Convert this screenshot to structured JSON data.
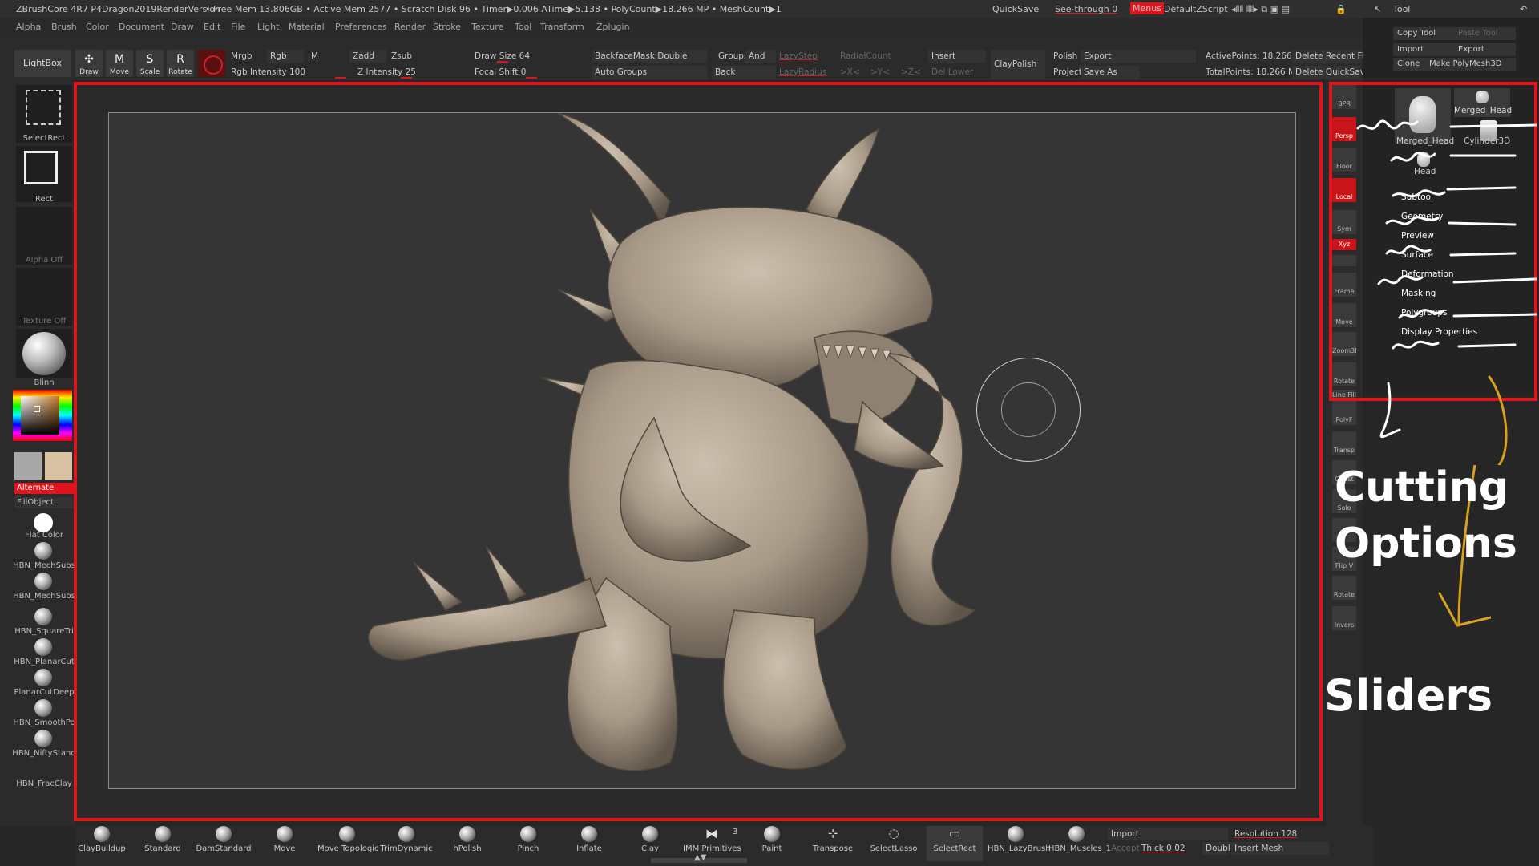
{
  "title_bar": {
    "app_title": "ZBrushCore 4R7 P4Dragon2019RenderVersion",
    "stats": "• Free Mem 13.806GB • Active Mem 2577 • Scratch Disk 96 • Timer▶0.006 ATime▶5.138 • PolyCount▶18.266 MP • MeshCount▶1",
    "quicksave": "QuickSave",
    "see_through": "See-through  0",
    "menus": "Menus",
    "default_zscript": "DefaultZScript",
    "tool_title": "Tool"
  },
  "menu_bar": [
    "Alpha",
    "Brush",
    "Color",
    "Document",
    "Draw",
    "Edit",
    "File",
    "Light",
    "Material",
    "Preferences",
    "Render",
    "Stroke",
    "Texture",
    "Tool",
    "Transform",
    "Zplugin"
  ],
  "toolbar": {
    "lightbox": "LightBox",
    "draw": "Draw",
    "move": "Move",
    "scale": "Scale",
    "rotate": "Rotate",
    "mrgb": "Mrgb",
    "rgb": "Rgb",
    "m": "M",
    "zadd": "Zadd",
    "zsub": "Zsub",
    "rgb_intensity": "Rgb Intensity 100",
    "z_intensity": "Z Intensity 25",
    "draw_size": "Draw Size 64",
    "focal_shift": "Focal Shift 0",
    "backface_mask": "BackfaceMask  Double",
    "auto_groups": "Auto Groups",
    "groups": "Groups",
    "and": "And",
    "back": "Back",
    "lazy_step": "LazyStep",
    "lazy_radius": "LazyRadius",
    "radial_count": "RadialCount",
    "x_axis": ">X<",
    "y_axis": ">Y<",
    "z_axis": ">Z<",
    "insert": "Insert",
    "del_lower": "Del Lower",
    "claypolish": "ClayPolish",
    "polish": "Polish",
    "export": "Export",
    "project": "Project",
    "save_as": "Save As",
    "active_points": "ActivePoints: 18.266 M",
    "total_points": "TotalPoints: 18.266 Mil",
    "delete_recent": "Delete Recent Fi",
    "delete_quicksave": "Delete QuickSav"
  },
  "left_shelf": {
    "select_rect": "SelectRect",
    "rect": "Rect",
    "alpha_off": "Alpha Off",
    "texture_off": "Texture Off",
    "material": "Blinn",
    "alternate": "Alternate",
    "fill_object": "FillObject",
    "flat_color": "Flat Color",
    "brushes": [
      "HBN_MechSubs",
      "HBN_MechSubs",
      "HBN_SquareTri",
      "HBN_PlanarCut",
      "PlanarCutDeep",
      "HBN_SmoothPo",
      "HBN_NiftyStand",
      "HBN_FracClay"
    ]
  },
  "right_strip": [
    "BPR",
    "Persp",
    "Floor",
    "Local",
    "Sym",
    "Xyz",
    "",
    "Frame",
    "Move",
    "Zoom3D",
    "Rotate",
    "Line Fill",
    "PolyF",
    "Transp",
    "Ghost",
    "Solo",
    "",
    "Flip V",
    "Rotate",
    "Invers"
  ],
  "tool_panel": {
    "copy_tool": "Copy Tool",
    "paste_tool": "Paste Tool",
    "import": "Import",
    "export": "Export",
    "clone": "Clone",
    "make_polymesh": "Make PolyMesh3D",
    "thumb1": "Merged_Head",
    "thumb2": "Merged_Head",
    "thumb3": "Cylinder3D",
    "thumb4": "Head",
    "items": [
      "Subtool",
      "Geometry",
      "Preview",
      "Surface",
      "Deformation",
      "Masking",
      "Polygroups",
      "Display Properties"
    ]
  },
  "annotations": {
    "line1": "Cutting",
    "line2": "Options",
    "line3": "Sliders"
  },
  "bottom_shelf": {
    "brushes": [
      "ClayBuildup",
      "Standard",
      "DamStandard",
      "Move",
      "Move Topologic",
      "TrimDynamic",
      "hPolish",
      "Pinch",
      "Inflate",
      "Clay",
      "IMM Primitives",
      "Paint",
      "Transpose",
      "SelectLasso",
      "SelectRect",
      "HBN_LazyBrush",
      "HBN_Muscles_1"
    ],
    "imm_count": "3",
    "import": "Import",
    "accept": "Accept",
    "thick": "Thick 0.02",
    "double": "Doubl",
    "resolution": "Resolution 128",
    "insert_mesh": "Insert Mesh"
  },
  "colors": {
    "accent_red": "#e0141c",
    "bg": "#262626",
    "yellow_annotation": "#d8a21c",
    "sculpt_clay": "#a99a88"
  }
}
